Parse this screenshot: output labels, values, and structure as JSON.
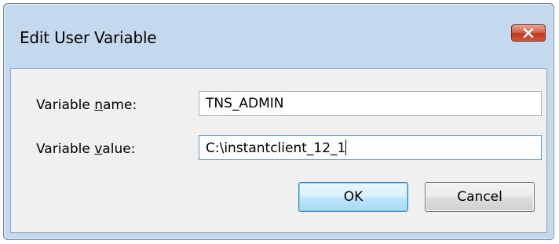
{
  "dialog": {
    "title": "Edit User Variable",
    "close_icon": "close-x-icon",
    "close_color": "#c7452a"
  },
  "fields": {
    "name_label_prefix": "Variable ",
    "name_label_accel": "n",
    "name_label_suffix": "ame:",
    "name_value": "TNS_ADMIN",
    "value_label_prefix": "Variable ",
    "value_label_accel": "v",
    "value_label_suffix": "alue:",
    "value_value": "C:\\instantclient_12_1"
  },
  "buttons": {
    "ok_label": "OK",
    "cancel_label": "Cancel"
  }
}
